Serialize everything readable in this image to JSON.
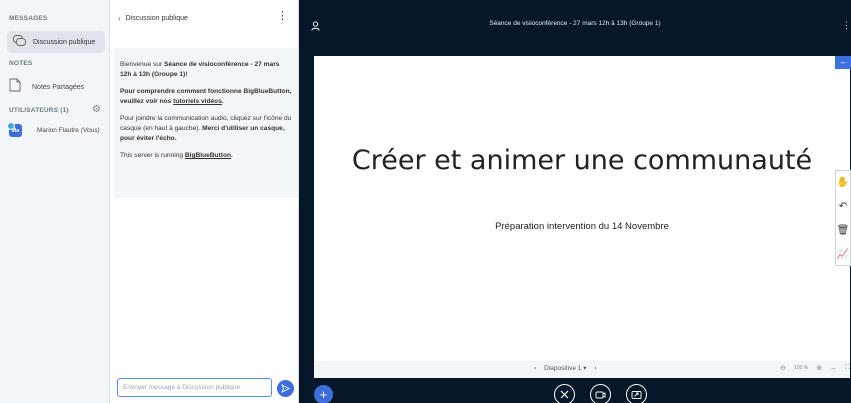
{
  "sidebar": {
    "messages_title": "MESSAGES",
    "public_chat_label": "Discussion publique",
    "notes_title": "NOTES",
    "shared_notes_label": "Notes Partagées",
    "users_title": "UTILISATEURS (1)",
    "user": {
      "initials": "Ma",
      "name": "Marion Flautre",
      "suffix": "(Vous)"
    }
  },
  "chat": {
    "header_title": "Discussion publique",
    "welcome": {
      "p1_pre": "Bienvenue sur ",
      "p1_bold": "Séance de visioconférence - 27 mars 12h à 13h (Groupe 1)",
      "p1_post": "!",
      "p2_pre": "Pour comprendre comment fonctionne BigBlueButton, veuillez voir nos ",
      "p2_link": "tutoriels vidéos",
      "p2_post": ".",
      "p3_pre": "Pour joindre la communication audio, cliquez sur l'icône du casque (en haut à gauche). ",
      "p3_bold": "Merci d'utiliser un casque, pour éviter l'écho.",
      "p4_pre": "This server is running ",
      "p4_link": "BigBlueButton",
      "p4_post": "."
    },
    "input_placeholder": "Envoyer message à Discussion publique"
  },
  "main": {
    "meeting_title": "Séance de visioconférence - 27 mars 12h à 13h (Groupe 1)",
    "slide_title": "Créer et animer une communauté",
    "slide_subtitle": "Préparation intervention du 14 Novembre",
    "slide_label": "Diapositive 1",
    "zoom_level": "100 %"
  },
  "colors": {
    "accent": "#3c6fdc",
    "dark_bg": "#06172a",
    "sidebar_bg": "#f3f6f9"
  }
}
